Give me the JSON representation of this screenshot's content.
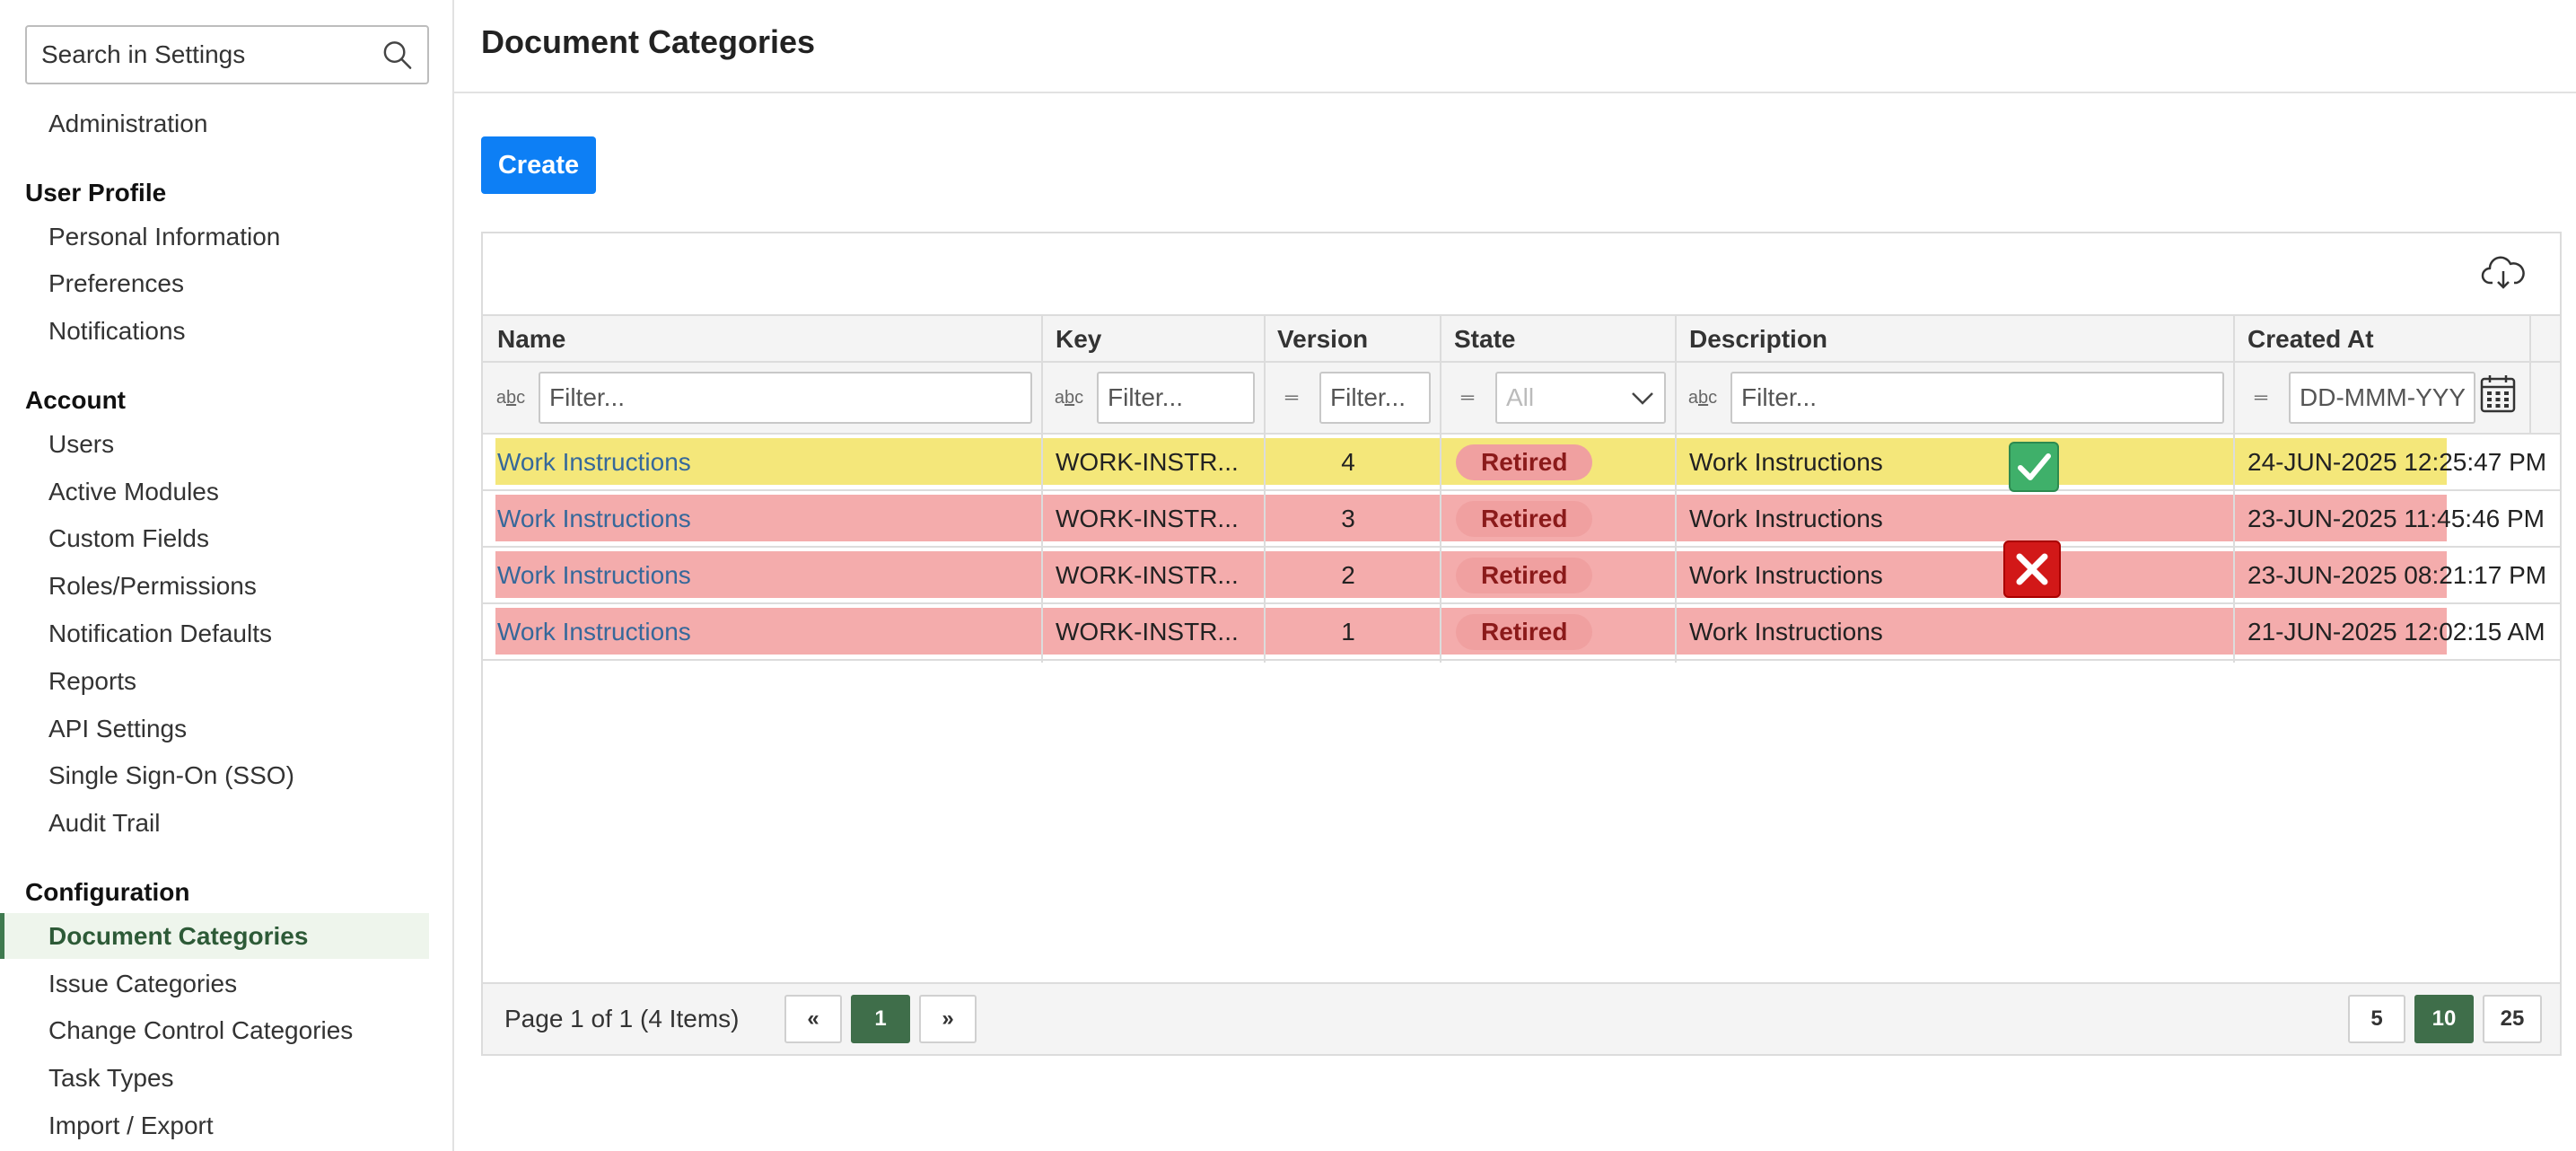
{
  "search": {
    "placeholder": "Search in Settings"
  },
  "sidebar": {
    "top_item": "Administration",
    "sections": [
      {
        "header": "User Profile",
        "items": [
          "Personal Information",
          "Preferences",
          "Notifications"
        ]
      },
      {
        "header": "Account",
        "items": [
          "Users",
          "Active Modules",
          "Custom Fields",
          "Roles/Permissions",
          "Notification Defaults",
          "Reports",
          "API Settings",
          "Single Sign-On (SSO)",
          "Audit Trail"
        ]
      },
      {
        "header": "Configuration",
        "items": [
          "Document Categories",
          "Issue Categories",
          "Change Control Categories",
          "Task Types",
          "Import / Export"
        ]
      }
    ],
    "active_item": "Document Categories"
  },
  "page": {
    "title": "Document Categories",
    "create_label": "Create"
  },
  "table": {
    "columns": [
      "Name",
      "Key",
      "Version",
      "State",
      "Description",
      "Created At"
    ],
    "filters": {
      "name_placeholder": "Filter...",
      "key_placeholder": "Filter...",
      "version_placeholder": "Filter...",
      "state_selected": "All",
      "description_placeholder": "Filter...",
      "created_placeholder": "DD-MMM-YYYY"
    },
    "rows": [
      {
        "name": "Work Instructions",
        "key": "WORK-INSTR...",
        "version": "4",
        "state": "Retired",
        "description": "Work Instructions",
        "created_at": "24-JUN-2025 12:25:47 PM",
        "highlight": "#f4e77a"
      },
      {
        "name": "Work Instructions",
        "key": "WORK-INSTR...",
        "version": "3",
        "state": "Retired",
        "description": "Work Instructions",
        "created_at": "23-JUN-2025 11:45:46 PM",
        "highlight": "#f4acac"
      },
      {
        "name": "Work Instructions",
        "key": "WORK-INSTR...",
        "version": "2",
        "state": "Retired",
        "description": "Work Instructions",
        "created_at": "23-JUN-2025 08:21:17 PM",
        "highlight": "#f4acac"
      },
      {
        "name": "Work Instructions",
        "key": "WORK-INSTR...",
        "version": "1",
        "state": "Retired",
        "description": "Work Instructions",
        "created_at": "21-JUN-2025 12:02:15 AM",
        "highlight": "#f4acac"
      }
    ],
    "markers": {
      "check": "check-mark-icon",
      "cross": "cross-mark-icon"
    }
  },
  "pagination": {
    "info": "Page 1 of 1 (4 Items)",
    "prev": "«",
    "current": "1",
    "next": "»",
    "page_sizes": [
      "5",
      "10",
      "25"
    ],
    "active_page_size": "10"
  },
  "colors": {
    "primary": "#0d7ff5",
    "active_green": "#3f6e4a",
    "badge_bg": "#f0a0a0",
    "link": "#36689a"
  }
}
